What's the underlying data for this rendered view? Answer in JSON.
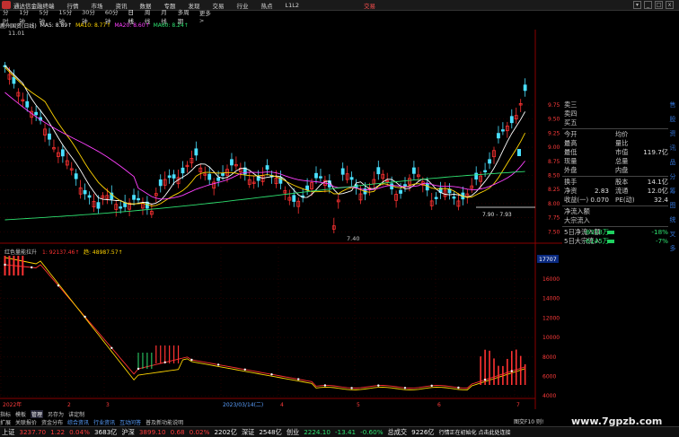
{
  "menu": {
    "app_title": "通达信金融终端",
    "items": [
      "行情",
      "市场",
      "资讯",
      "数据",
      "专题",
      "发现",
      "交易",
      "行业",
      "热点",
      "L1L2"
    ],
    "trade_label": "交易",
    "window_controls": [
      "▾",
      "_",
      "□",
      "x"
    ]
  },
  "periods": {
    "items": [
      "分时",
      "1分钟",
      "5分钟",
      "15分钟",
      "30分钟",
      "60分钟",
      "日线",
      "周线",
      "月线",
      "多周期",
      "更多"
    ],
    "active": "日线",
    "more_suffix": ">"
  },
  "indicator": {
    "name": "鹿州国资(日线)",
    "ma5": "MA5: 8.89↑",
    "ma10": "MA10: 8.77↑",
    "ma20": "MA20: 8.60↑",
    "ma60": "MA60: 8.24↑"
  },
  "chart": {
    "price_high_label": "11.01",
    "price_low_label": "7.40",
    "range_label": "7.90 - 7.93",
    "y_ticks": [
      "9.75",
      "9.50",
      "9.25",
      "9.00",
      "8.75",
      "8.50",
      "8.25",
      "8.00",
      "7.75",
      "7.50"
    ],
    "sub_title": "红色量能拉升",
    "sub_value1": "1: 92137.46↑",
    "sub_value2": "趋: 48987.57↑",
    "sub_y_ticks": [
      "16000",
      "14000",
      "12000",
      "10000",
      "8000",
      "6000",
      "4000"
    ],
    "sub_top_value": "17707",
    "x_labels": [
      "2022年",
      "2",
      "3",
      "2023/03/14(二)",
      "4",
      "5",
      "6",
      "7"
    ],
    "colors": {
      "up": "#ff3232",
      "down": "#4ae0ff",
      "ma5": "#ffffff",
      "ma10": "#ffd400",
      "ma20": "#ff40ff",
      "ma60": "#2ee070"
    }
  },
  "quote": {
    "rows": [
      {
        "l": "卖三",
        "m": "",
        "v1": "",
        "v2": ""
      },
      {
        "l": "卖四",
        "m": "",
        "v1": "",
        "v2": ""
      },
      {
        "l": "买五",
        "m": "",
        "v1": "",
        "v2": ""
      },
      {
        "l": "今开",
        "m": "均价",
        "v1": "",
        "v2": ""
      },
      {
        "l": "最高",
        "m": "量比",
        "v1": "",
        "v2": ""
      },
      {
        "l": "最低",
        "m": "市值",
        "v1": "",
        "v2": "119.7亿"
      },
      {
        "l": "现量",
        "m": "总量",
        "v1": "",
        "v2": ""
      },
      {
        "l": "外盘",
        "m": "内盘",
        "v1": "",
        "v2": ""
      },
      {
        "l": "换手",
        "m": "股本",
        "v1": "",
        "v2": "14.1亿"
      },
      {
        "l": "净资",
        "m": "流通",
        "v1": "2.83",
        "v2": "12.0亿"
      },
      {
        "l": "收益(一)",
        "m": "PE(动)",
        "v1": "0.070",
        "v2": "32.4"
      },
      {
        "l": "净流入额",
        "m": "",
        "v1": "",
        "v2": ""
      },
      {
        "l": "大宗流入",
        "m": "",
        "v1": "",
        "v2": ""
      },
      {
        "l": "5日净流入额",
        "m": "",
        "v1": "-8318万",
        "v2": "-18%"
      },
      {
        "l": "5日大宗流入",
        "m": "",
        "v1": "-6145万",
        "v2": "-7%"
      }
    ]
  },
  "tabs_row1": [
    "指标",
    "模板",
    "管理",
    "另存为",
    "讲定制"
  ],
  "tabs_row2": [
    "扩展",
    "关联报价",
    "资金分布",
    "综合资讯",
    "行业资讯",
    "互动问答",
    "普及新功能说明"
  ],
  "help_text": "图交F10 则!",
  "status": {
    "sh_name": "上证",
    "sh_val": "3237.70",
    "sh_chg": "1.22",
    "sh_pct": "0.04%",
    "sh_amt": "3683亿",
    "hs_name": "沪深",
    "hs_val": "3899.10",
    "hs_chg": "0.68",
    "hs_pct": "0.02%",
    "hs_amt": "2202亿",
    "sz_name": "深证",
    "sz_amt": "2548亿",
    "cy_name": "创业",
    "cy_val": "2224.10",
    "cy_chg": "-13.41",
    "cy_pct": "-0.60%",
    "total_name": "总成交",
    "total_amt": "9226亿",
    "conn": "行情正在初始化 点击此处连接"
  },
  "watermark": "www.7gpzb.com",
  "side_icons": [
    "售",
    "股",
    "资",
    "讯",
    "品",
    "分",
    "筹",
    "图",
    "统",
    "叉",
    "多"
  ]
}
